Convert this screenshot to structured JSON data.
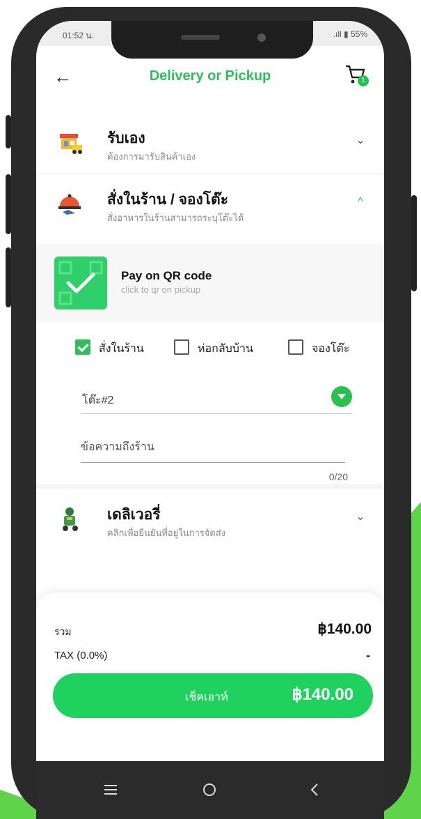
{
  "status": {
    "time": "01:52 น.",
    "signal_battery": ".ıll ▮ 55%"
  },
  "header": {
    "title": "Delivery or Pickup",
    "cart_badge": "1"
  },
  "sections": {
    "pickup": {
      "title": "รับเอง",
      "subtitle": "ต้องการมารับสินค้าเอง"
    },
    "dine_in": {
      "title": "สั่งในร้าน / จองโต๊ะ",
      "subtitle": "สั่งอาหารในร้านสามารถระบุโต๊ะได้"
    },
    "delivery": {
      "title": "เดลิเวอรี่",
      "subtitle": "คลิกเพื่อยืนยันที่อยู่ในการจัดส่ง"
    }
  },
  "qr": {
    "title": "Pay on QR code",
    "subtitle": "click to qr on pickup"
  },
  "options": [
    {
      "label": "สั่งในร้าน",
      "checked": true
    },
    {
      "label": "ห่อกลับบ้าน",
      "checked": false
    },
    {
      "label": "จองโต๊ะ",
      "checked": false
    }
  ],
  "table_select": {
    "value": "โต๊ะ#2"
  },
  "message": {
    "placeholder": "ข้อความถึงร้าน",
    "value": "",
    "counter": "0/20"
  },
  "summary": {
    "total_label": "รวม",
    "total_value": "฿140.00",
    "tax_label": "TAX (0.0%)",
    "tax_value": "-"
  },
  "checkout": {
    "label": "เช็คเอาท์",
    "amount": "฿140.00"
  },
  "colors": {
    "accent": "#2fbf5a",
    "button": "#1fd15d",
    "background_green": "#5fd34a"
  }
}
